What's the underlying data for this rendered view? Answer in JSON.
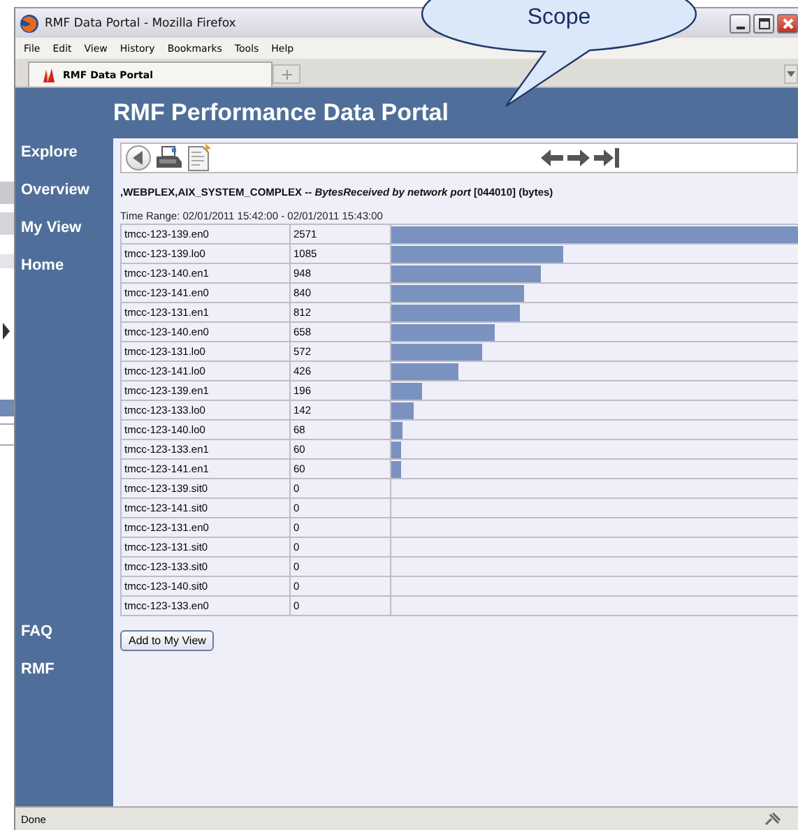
{
  "window": {
    "title": "RMF Data Portal - Mozilla Firefox"
  },
  "menu": [
    "File",
    "Edit",
    "View",
    "History",
    "Bookmarks",
    "Tools",
    "Help"
  ],
  "tabs": [
    {
      "label": "RMF Data Portal",
      "selected": true
    }
  ],
  "callout": {
    "lines": [
      "Scope"
    ]
  },
  "header": {
    "title": "RMF Performance Data Portal"
  },
  "sidebar": {
    "top_items": [
      "Explore",
      "Overview",
      "My View",
      "Home"
    ],
    "bottom_items": [
      "FAQ",
      "RMF"
    ]
  },
  "report": {
    "title": ",WEBPLEX,AIX_SYSTEM_COMPLEX -- *BytesReceived by network port* [044010] (bytes)",
    "time_range": "Time Range: 02/01/2011 15:42:00 - 02/01/2011 15:43:00"
  },
  "table": {
    "rows": [
      {
        "name": "tmcc-123-139.en0",
        "value": "2571",
        "level": 1.0
      },
      {
        "name": "tmcc-123-139.lo0",
        "value": "1085",
        "level": 0.422
      },
      {
        "name": "tmcc-123-140.en1",
        "value": "948",
        "level": 0.369
      },
      {
        "name": "tmcc-123-141.en0",
        "value": "840",
        "level": 0.327
      },
      {
        "name": "tmcc-123-131.en1",
        "value": "812",
        "level": 0.316
      },
      {
        "name": "tmcc-123-140.en0",
        "value": "658",
        "level": 0.256
      },
      {
        "name": "tmcc-123-131.lo0",
        "value": "572",
        "level": 0.222
      },
      {
        "name": "tmcc-123-141.lo0",
        "value": "426",
        "level": 0.166
      },
      {
        "name": "tmcc-123-139.en1",
        "value": "196",
        "level": 0.076
      },
      {
        "name": "tmcc-123-133.lo0",
        "value": "142",
        "level": 0.055
      },
      {
        "name": "tmcc-123-140.lo0",
        "value": "68",
        "level": 0.026
      },
      {
        "name": "tmcc-123-133.en1",
        "value": "60",
        "level": 0.023
      },
      {
        "name": "tmcc-123-141.en1",
        "value": "60",
        "level": 0.023
      },
      {
        "name": "tmcc-123-139.sit0",
        "value": "0"
      },
      {
        "name": "tmcc-123-141.sit0",
        "value": "0"
      },
      {
        "name": "tmcc-123-131.en0",
        "value": "0"
      },
      {
        "name": "tmcc-123-131.sit0",
        "value": "0"
      },
      {
        "name": "tmcc-123-133.sit0",
        "value": "0"
      },
      {
        "name": "tmcc-123-140.sit0",
        "value": "0"
      },
      {
        "name": "tmcc-123-133.en0",
        "value": "0"
      }
    ]
  },
  "add_button": "Add to My View",
  "status_bar": {
    "text": "Done"
  }
}
